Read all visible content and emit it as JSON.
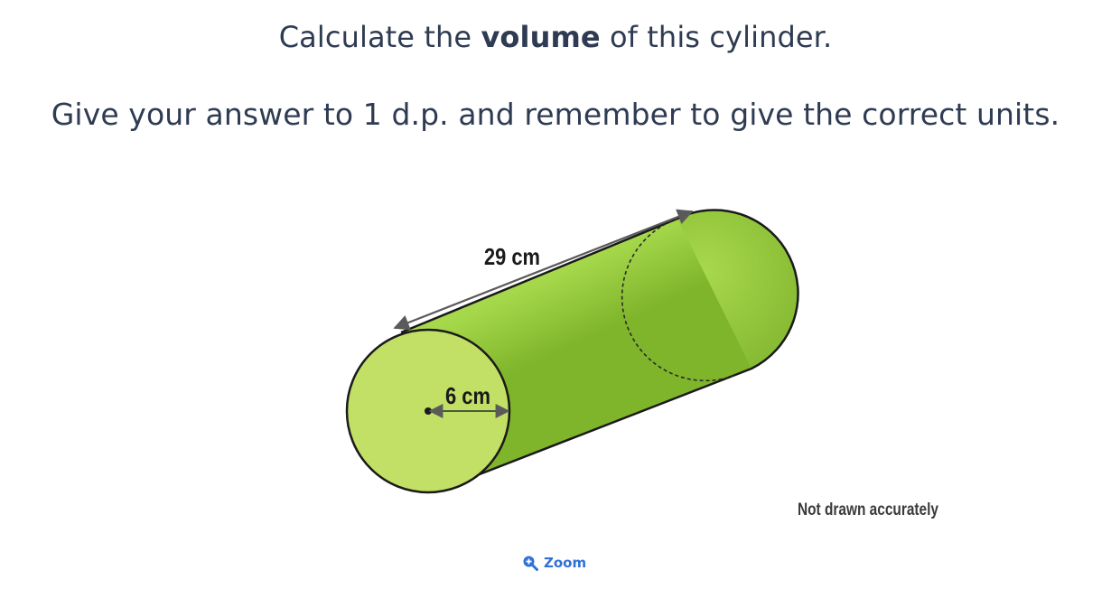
{
  "question": {
    "line1_before": "Calculate the ",
    "line1_bold": "volume",
    "line1_after": " of this cylinder.",
    "line2": "Give your answer to 1 d.p. and remember to give the correct units."
  },
  "diagram": {
    "length_label": "29 cm",
    "radius_label": "6 cm",
    "note": "Not drawn accurately",
    "colors": {
      "body_light": "#b3e05a",
      "body_dark": "#7fb52b",
      "front_face": "#c2df66",
      "outline": "#1a1a1a",
      "arrow": "#5a5a5a"
    }
  },
  "zoom": {
    "label": "Zoom",
    "icon": "zoom-in-icon",
    "color": "#2f72d6"
  }
}
